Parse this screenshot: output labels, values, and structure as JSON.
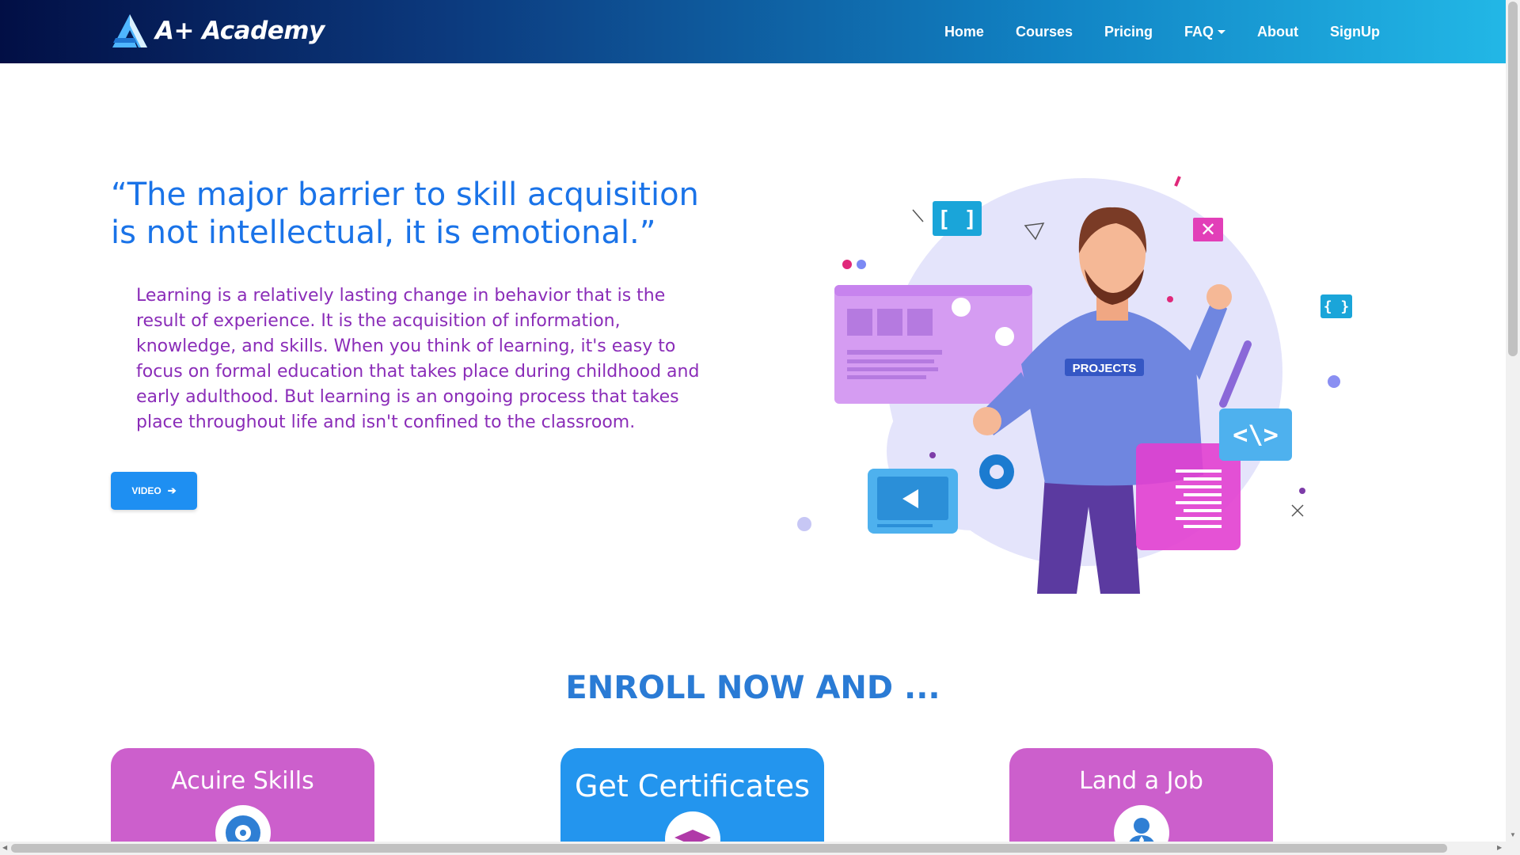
{
  "brand": {
    "name": "A+ Academy",
    "logo_icon": "triangle-logo-icon"
  },
  "nav": {
    "items": [
      {
        "label": "Home"
      },
      {
        "label": "Courses"
      },
      {
        "label": "Pricing"
      },
      {
        "label": "FAQ",
        "dropdown": true
      },
      {
        "label": "About"
      },
      {
        "label": "SignUp"
      }
    ]
  },
  "hero": {
    "quote": "“The major barrier to skill acquisition is not intellectual, it is emotional.”",
    "paragraph": "Learning is a relatively lasting change in behavior that is the result of experience. It is the acquisition of information, knowledge, and skills. When you think of learning, it's easy to focus on formal education that takes place during childhood and early adulthood. But learning is an ongoing process that takes place throughout life and isn't confined to the classroom.",
    "video_button": "VIDEO",
    "illustration_label": "PROJECTS"
  },
  "enroll": {
    "heading": "ENROLL NOW AND ...",
    "cards": [
      {
        "title": "Acuire Skills",
        "icon": "brain-gear-icon"
      },
      {
        "title": "Get Certificates",
        "icon": "graduation-cap-icon"
      },
      {
        "title": "Land a Job",
        "icon": "businessman-icon"
      }
    ]
  },
  "colors": {
    "nav_gradient": [
      "#020f45",
      "#22b7e6"
    ],
    "quote": "#1a73e8",
    "paragraph": "#8a2cb8",
    "button": "#1e8ff2",
    "card_pink": "#cc5fcc",
    "card_blue": "#2395ee"
  }
}
